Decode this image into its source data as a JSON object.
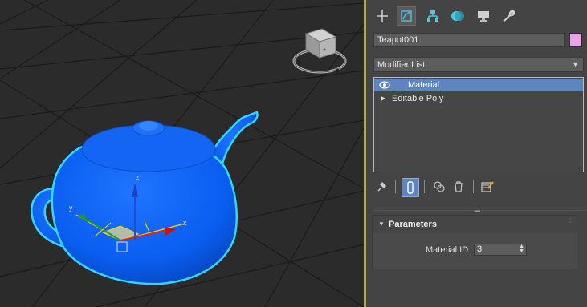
{
  "viewport": {
    "gizmo_labels": {
      "x": "x",
      "y": "y",
      "z": "z"
    },
    "object_color": "#0a5ef0",
    "selection_outline_color": "#34d6ff"
  },
  "command_panel": {
    "tabs": [
      {
        "name": "create",
        "icon": "plus-icon"
      },
      {
        "name": "modify",
        "icon": "modify-icon",
        "active": true
      },
      {
        "name": "hierarchy",
        "icon": "hierarchy-icon"
      },
      {
        "name": "motion",
        "icon": "motion-icon"
      },
      {
        "name": "display",
        "icon": "display-icon"
      },
      {
        "name": "utilities",
        "icon": "wrench-icon"
      }
    ],
    "object_name": "Teapot001",
    "object_color": "#e9a3e9",
    "modifier_list_label": "Modifier List",
    "stack": [
      {
        "label": "Material",
        "selected": true,
        "icon": "eye-icon"
      },
      {
        "label": "Editable Poly",
        "selected": false,
        "icon": "expand-triangle-icon"
      }
    ],
    "parameters": {
      "title": "Parameters",
      "material_id_label": "Material ID:",
      "material_id_value": "3"
    }
  }
}
